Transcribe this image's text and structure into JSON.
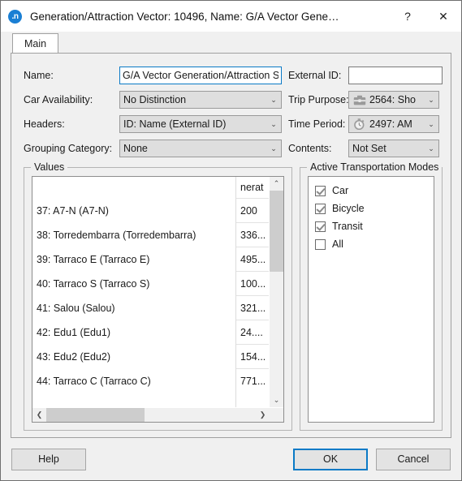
{
  "window": {
    "app_icon_label": ".n",
    "title": "Generation/Attraction Vector: 10496, Name: G/A Vector Gene…",
    "help_glyph": "?",
    "close_glyph": "✕"
  },
  "tabs": [
    {
      "label": "Main",
      "active": true
    }
  ],
  "form": {
    "name_label": "Name:",
    "name_value": "G/A Vector Generation/Attraction S",
    "external_id_label": "External ID:",
    "external_id_value": "",
    "car_availability_label": "Car Availability:",
    "car_availability_value": "No Distinction",
    "trip_purpose_label": "Trip Purpose:",
    "trip_purpose_value": "2564: Sho",
    "trip_purpose_icon": "briefcase-icon",
    "headers_label": "Headers:",
    "headers_value": "ID: Name (External ID)",
    "time_period_label": "Time Period:",
    "time_period_value": "2497: AM",
    "time_period_icon": "stopwatch-icon",
    "grouping_category_label": "Grouping Category:",
    "grouping_category_value": "None",
    "contents_label": "Contents:",
    "contents_value": "Not Set",
    "dropdown_arrow": "⌄"
  },
  "values_group": {
    "title": "Values",
    "column_headers": [
      "",
      "nerat"
    ],
    "rows": [
      {
        "name": "37: A7-N (A7-N)",
        "value": "200"
      },
      {
        "name": "38: Torredembarra (Torredembarra)",
        "value": "336..."
      },
      {
        "name": "39: Tarraco E (Tarraco E)",
        "value": "495..."
      },
      {
        "name": "40: Tarraco S (Tarraco S)",
        "value": "100..."
      },
      {
        "name": "41: Salou (Salou)",
        "value": "321..."
      },
      {
        "name": "42: Edu1 (Edu1)",
        "value": "24...."
      },
      {
        "name": "43: Edu2 (Edu2)",
        "value": "154..."
      },
      {
        "name": "44: Tarraco C (Tarraco C)",
        "value": "771..."
      }
    ],
    "scroll_up_glyph": "⌃",
    "scroll_down_glyph": "⌄",
    "scroll_left_glyph": "❮",
    "scroll_right_glyph": "❯"
  },
  "modes_group": {
    "title": "Active Transportation Modes",
    "items": [
      {
        "label": "Car",
        "checked": true
      },
      {
        "label": "Bicycle",
        "checked": true
      },
      {
        "label": "Transit",
        "checked": true
      },
      {
        "label": "All",
        "checked": false
      }
    ]
  },
  "footer": {
    "help_label": "Help",
    "ok_label": "OK",
    "cancel_label": "Cancel"
  },
  "colors": {
    "accent": "#0a7ac6",
    "dialog_bg": "#f0f0f0",
    "combo_bg": "#dedede",
    "amber_text": "#b07a10"
  }
}
